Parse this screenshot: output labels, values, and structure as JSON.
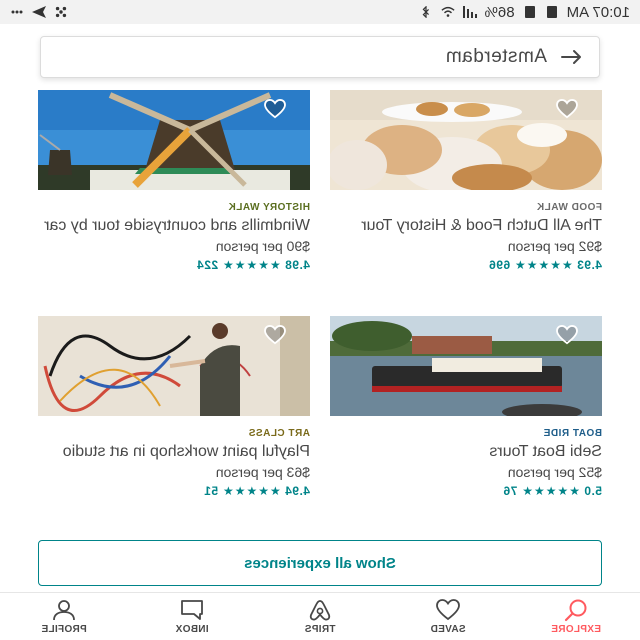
{
  "status_bar": {
    "time": "10:07 AM",
    "battery": "86%"
  },
  "search": {
    "value": "Amsterdam"
  },
  "cards": [
    {
      "category": "FOOD WALK",
      "category_color": "#6b6b6b",
      "title": "The All Dutch Food & History Tour",
      "price": "$92 per person",
      "rating": "4.93",
      "stars": "★★★★★",
      "reviews": "696"
    },
    {
      "category": "HISTORY WALK",
      "category_color": "#5a6e1f",
      "title": "Windmills and countryside tour by car",
      "price": "$90 per person",
      "rating": "4.98",
      "stars": "★★★★★",
      "reviews": "224"
    },
    {
      "category": "BOAT RIDE",
      "category_color": "#1f5e8a",
      "title": "Sebi Boat Tours",
      "price": "$52 per person",
      "rating": "5.0",
      "stars": "★★★★★",
      "reviews": "76"
    },
    {
      "category": "ART CLASS",
      "category_color": "#7a6a1a",
      "title": "Playful paint workshop in art studio",
      "price": "$63 per person",
      "rating": "4.94",
      "stars": "★★★★★",
      "reviews": "51"
    }
  ],
  "show_all_label": "Show all experiences",
  "nav": {
    "explore": "EXPLORE",
    "saved": "SAVED",
    "trips": "TRIPS",
    "inbox": "INBOX",
    "profile": "PROFILE"
  },
  "colors": {
    "accent": "#008489",
    "brand": "#ff5a5f"
  }
}
